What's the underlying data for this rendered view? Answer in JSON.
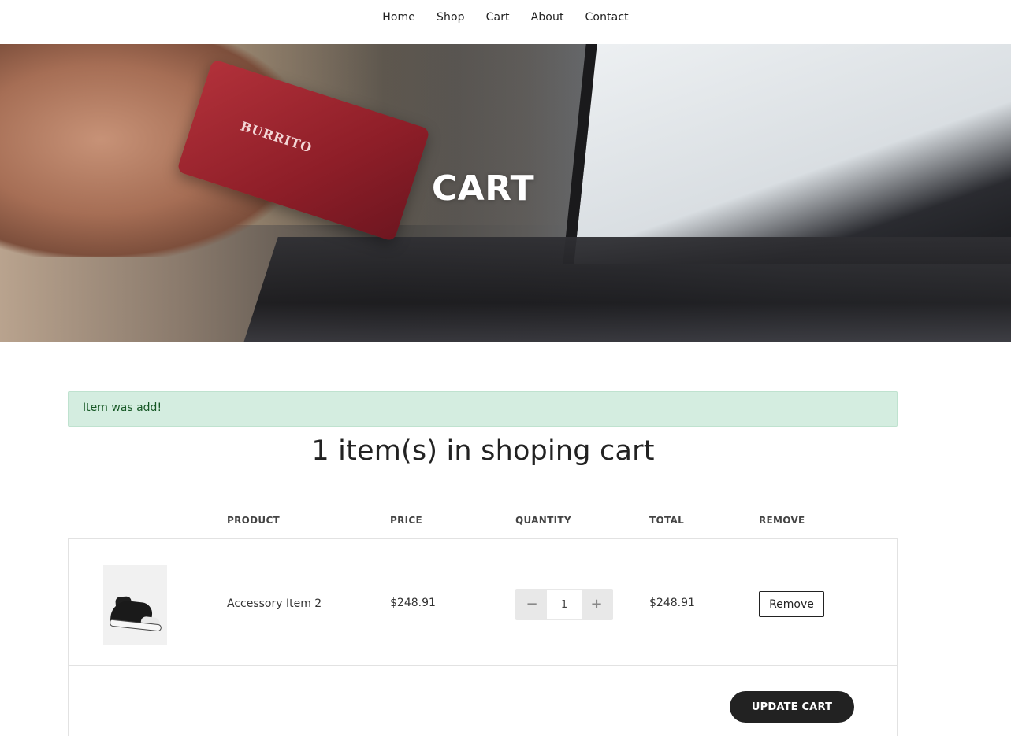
{
  "nav": {
    "items": [
      {
        "label": "Home"
      },
      {
        "label": "Shop"
      },
      {
        "label": "Cart"
      },
      {
        "label": "About"
      },
      {
        "label": "Contact"
      }
    ]
  },
  "hero": {
    "title": "CART",
    "card_text": "BURRITO"
  },
  "alert": {
    "message": "Item was add!"
  },
  "cart": {
    "heading": "1 item(s) in shoping cart",
    "columns": {
      "product": "PRODUCT",
      "price": "PRICE",
      "quantity": "QUANTITY",
      "total": "TOTAL",
      "remove": "REMOVE"
    },
    "items": [
      {
        "name": "Accessory Item 2",
        "price": "$248.91",
        "quantity": "1",
        "total": "$248.91",
        "remove_label": "Remove",
        "image_icon": "sneaker-image"
      }
    ],
    "stepper": {
      "minus": "−",
      "plus": "+"
    },
    "update_label": "UPDATE CART"
  },
  "colors": {
    "alert_bg": "#d4ede0",
    "alert_text": "#155724",
    "button_dark": "#222222"
  }
}
